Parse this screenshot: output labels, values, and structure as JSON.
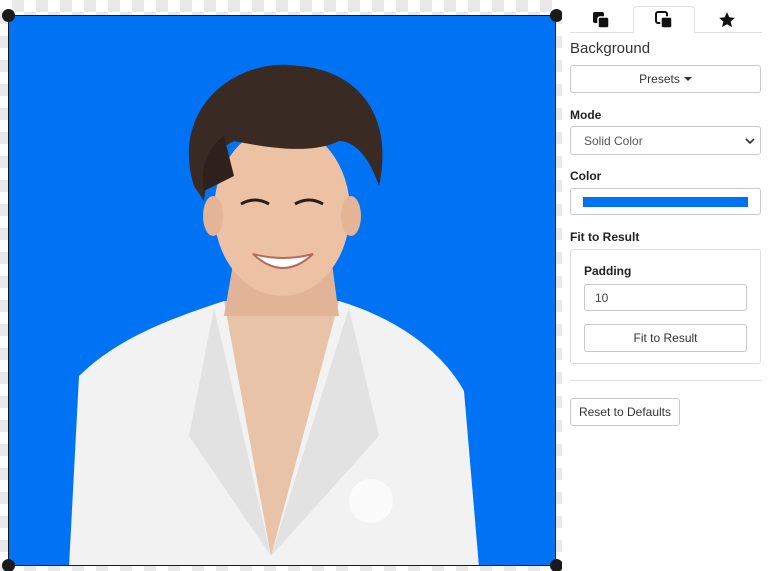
{
  "editor": {
    "background_color": "#0073f5",
    "image_subject": "person-cutout"
  },
  "tabs": [
    {
      "icon": "layers-icon"
    },
    {
      "icon": "copy-icon",
      "active": true
    },
    {
      "icon": "star-icon"
    }
  ],
  "panel": {
    "title": "Background",
    "presets_label": "Presets",
    "mode_label": "Mode",
    "mode_value": "Solid Color",
    "color_label": "Color",
    "color_value": "#0073f5",
    "fit_label": "Fit to Result",
    "padding_label": "Padding",
    "padding_value": "10",
    "fit_button_label": "Fit to Result",
    "reset_label": "Reset to Defaults"
  }
}
